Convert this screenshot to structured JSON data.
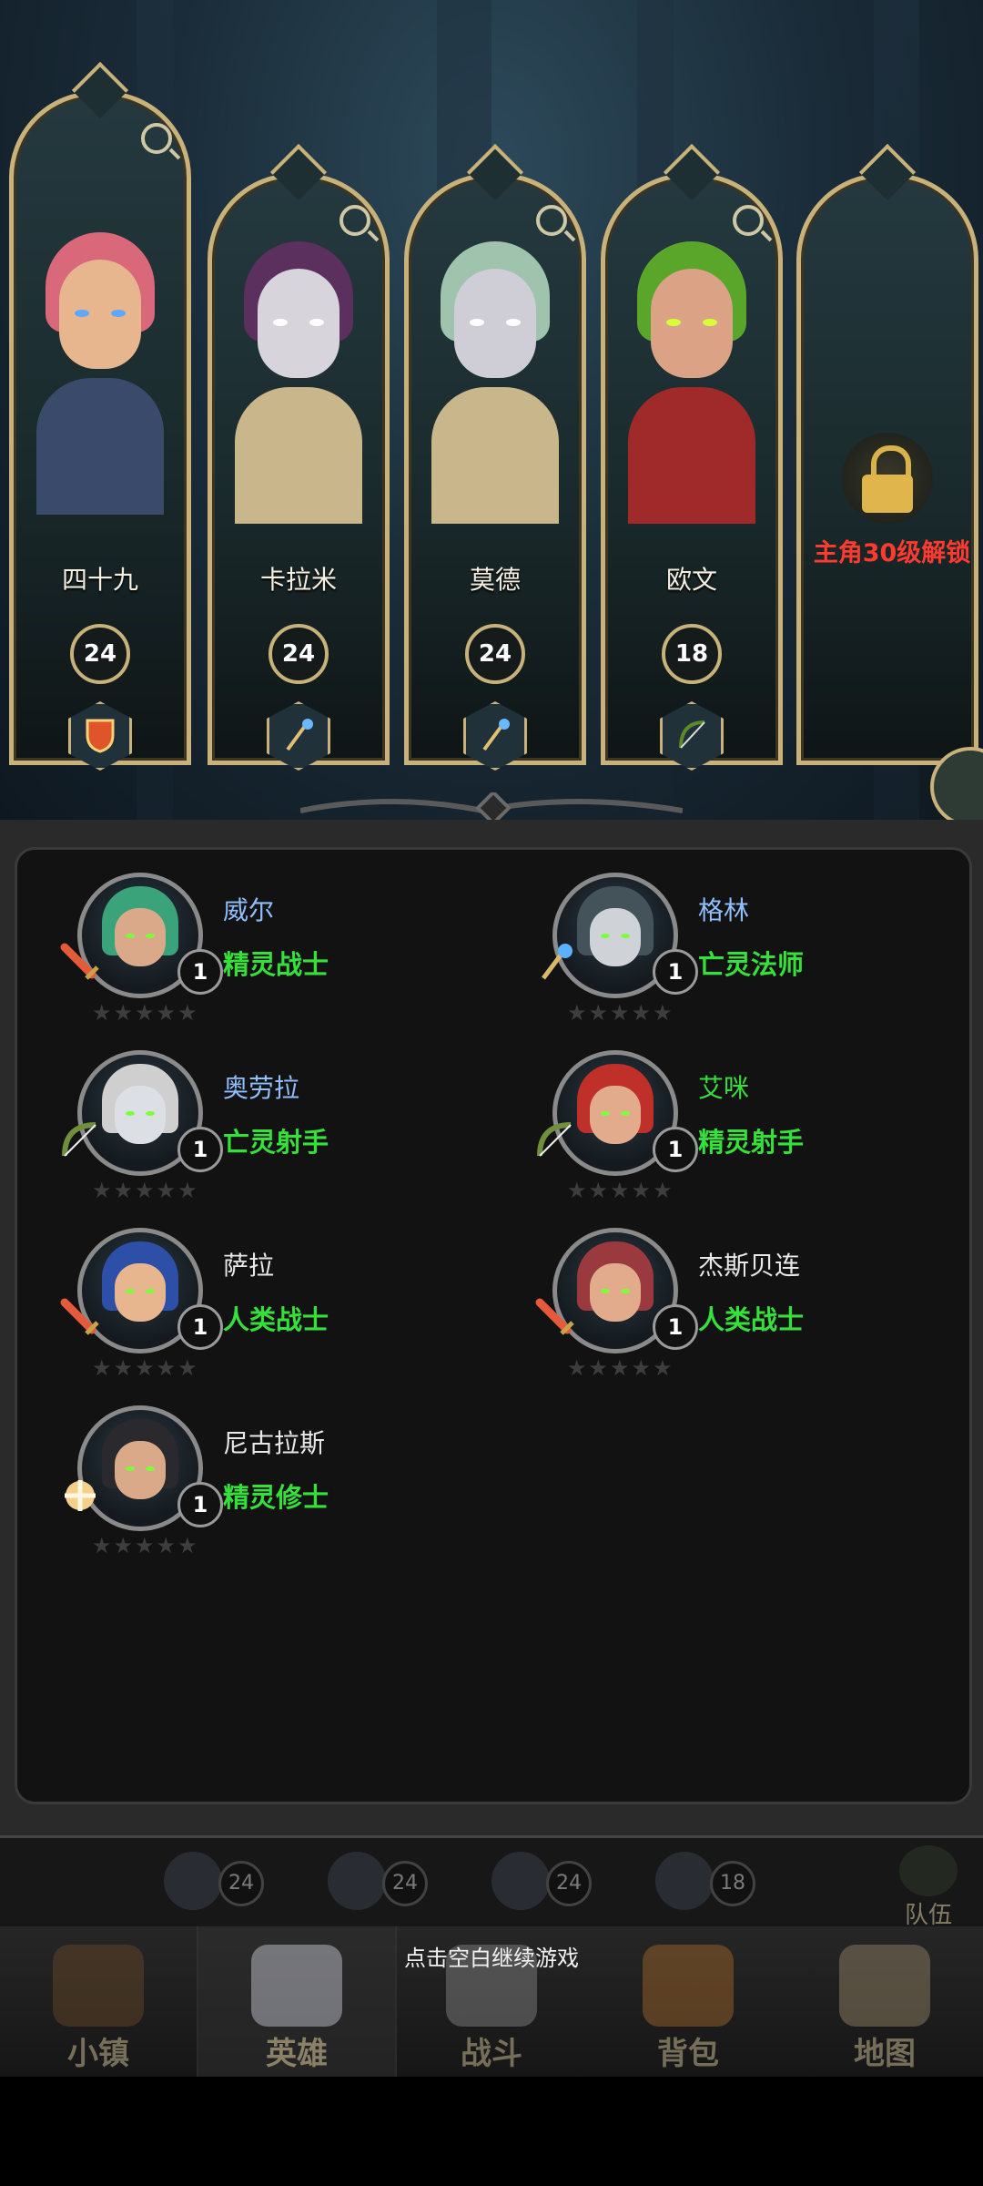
{
  "party": {
    "heroes": [
      {
        "name": "四十九",
        "level": "24",
        "class_icon": "shield-icon",
        "hair": "#d9687a",
        "skin": "#e7b58e",
        "body": "#3a4a6a",
        "eyes": "#5fa8ff"
      },
      {
        "name": "卡拉米",
        "level": "24",
        "class_icon": "staff-icon",
        "hair": "#5b2f5e",
        "skin": "#d7d4dc",
        "body": "#c9b68a",
        "eyes": "#ffffff"
      },
      {
        "name": "莫德",
        "level": "24",
        "class_icon": "staff-icon",
        "hair": "#9fc3ac",
        "skin": "#cfcdd5",
        "body": "#c9b68a",
        "eyes": "#ffffff"
      },
      {
        "name": "欧文",
        "level": "18",
        "class_icon": "bow-icon",
        "hair": "#5aa62b",
        "skin": "#dba285",
        "body": "#a02a2a",
        "eyes": "#d5ff3a"
      }
    ],
    "locked_slot": {
      "text": "主角30级解锁"
    }
  },
  "roster": [
    {
      "name": "威尔",
      "class": "精灵战士",
      "level": "1",
      "name_color": "#8fbfff",
      "hair": "#3aa37a",
      "skin": "#d9a98a",
      "weapon": "sword-icon"
    },
    {
      "name": "格林",
      "class": "亡灵法师",
      "level": "1",
      "name_color": "#8fbfff",
      "hair": "#44535a",
      "skin": "#cfd3d8",
      "weapon": "staff-icon"
    },
    {
      "name": "奥劳拉",
      "class": "亡灵射手",
      "level": "1",
      "name_color": "#8fbfff",
      "hair": "#cfcfcf",
      "skin": "#dcdfe4",
      "weapon": "bow-icon"
    },
    {
      "name": "艾咪",
      "class": "精灵射手",
      "level": "1",
      "name_color": "#35e03a",
      "hair": "#c0302a",
      "skin": "#e2ac8c",
      "weapon": "bow-icon"
    },
    {
      "name": "萨拉",
      "class": "人类战士",
      "level": "1",
      "name_color": "#e8e8e8",
      "hair": "#2e4fa8",
      "skin": "#e7b58e",
      "weapon": "sword-icon"
    },
    {
      "name": "杰斯贝连",
      "class": "人类战士",
      "level": "1",
      "name_color": "#e8e8e8",
      "hair": "#9a3a3e",
      "skin": "#e2ac8c",
      "weapon": "sword-icon"
    },
    {
      "name": "尼古拉斯",
      "class": "精灵修士",
      "level": "1",
      "name_color": "#e8e8e8",
      "hair": "#2a2a2e",
      "skin": "#d9a98a",
      "weapon": "holy-icon"
    }
  ],
  "stars": "★★★★★",
  "team_strip": {
    "levels": [
      "24",
      "24",
      "24",
      "18"
    ],
    "team_label": "队伍"
  },
  "nav": [
    {
      "label": "小镇",
      "icon": "town-icon"
    },
    {
      "label": "英雄",
      "icon": "hero-icon"
    },
    {
      "label": "战斗",
      "icon": "battle-icon"
    },
    {
      "label": "背包",
      "icon": "backpack-icon"
    },
    {
      "label": "地图",
      "icon": "map-icon"
    }
  ],
  "hint": "点击空白继续游戏"
}
